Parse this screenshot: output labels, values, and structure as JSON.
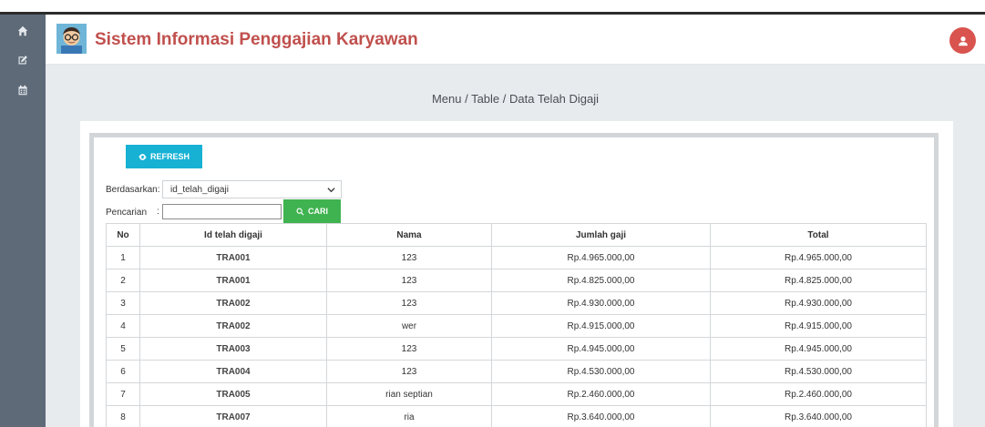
{
  "header": {
    "title": "Sistem Informasi Penggajian Karyawan",
    "logo_icon": "avatar-logo-icon",
    "user_icon": "user-icon"
  },
  "sidebar": {
    "items": [
      {
        "icon": "home-icon"
      },
      {
        "icon": "edit-icon"
      },
      {
        "icon": "calendar-icon"
      }
    ]
  },
  "breadcrumb": "Menu / Table / Data Telah Digaji",
  "toolbar": {
    "refresh_label": "REFRESH",
    "filter_label": "Berdasarkan:",
    "filter_value": "id_telah_digaji",
    "search_label": "Pencarian",
    "search_separator": ":",
    "search_value": "",
    "search_button_label": "CARI"
  },
  "table": {
    "headers": [
      "No",
      "Id telah digaji",
      "Nama",
      "Jumlah gaji",
      "Total"
    ],
    "rows": [
      [
        "1",
        "TRA001",
        "123",
        "Rp.4.965.000,00",
        "Rp.4.965.000,00"
      ],
      [
        "2",
        "TRA001",
        "123",
        "Rp.4.825.000,00",
        "Rp.4.825.000,00"
      ],
      [
        "3",
        "TRA002",
        "123",
        "Rp.4.930.000,00",
        "Rp.4.930.000,00"
      ],
      [
        "4",
        "TRA002",
        "wer",
        "Rp.4.915.000,00",
        "Rp.4.915.000,00"
      ],
      [
        "5",
        "TRA003",
        "123",
        "Rp.4.945.000,00",
        "Rp.4.945.000,00"
      ],
      [
        "6",
        "TRA004",
        "123",
        "Rp.4.530.000,00",
        "Rp.4.530.000,00"
      ],
      [
        "7",
        "TRA005",
        "rian septian",
        "Rp.2.460.000,00",
        "Rp.2.460.000,00"
      ],
      [
        "8",
        "TRA007",
        "ria",
        "Rp.3.640.000,00",
        "Rp.3.640.000,00"
      ]
    ]
  },
  "colors": {
    "title": "#c0504d",
    "sidebar": "#5e6a78",
    "refresh_button": "#17b1d4",
    "search_button": "#3fb34f",
    "user_button": "#d9534f"
  }
}
